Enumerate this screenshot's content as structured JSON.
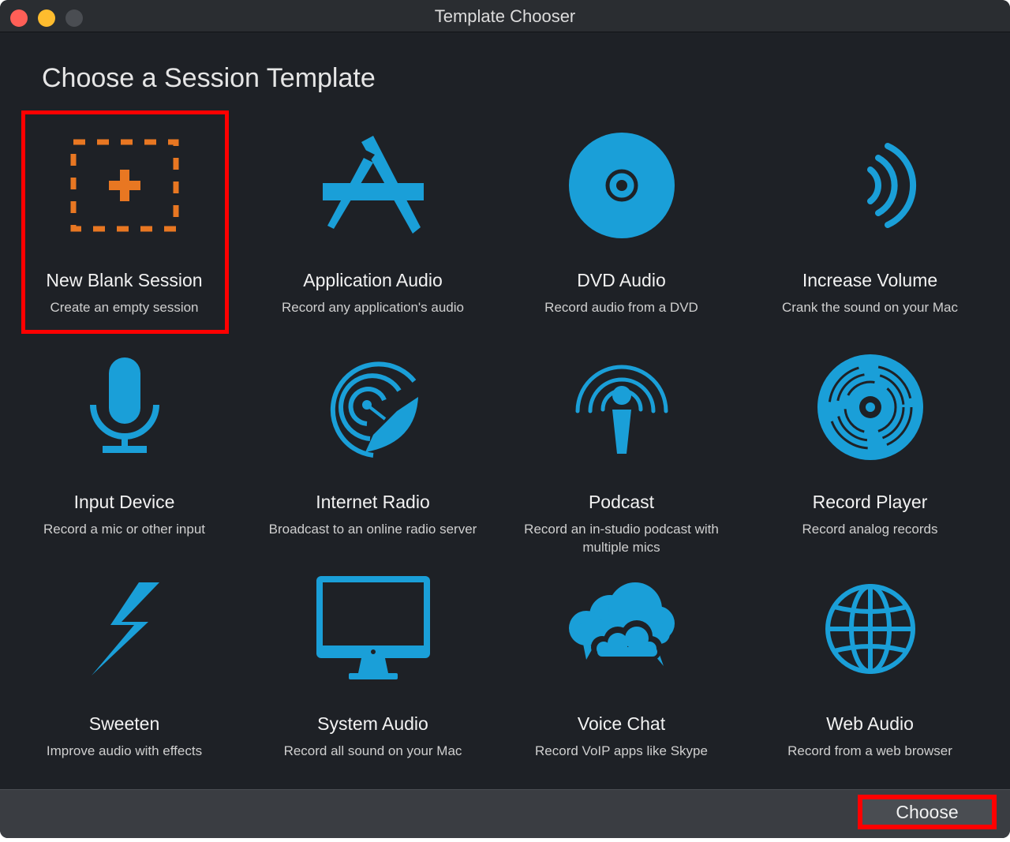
{
  "window": {
    "title": "Template Chooser"
  },
  "heading": "Choose a Session Template",
  "accent_color": "#1a9fd8",
  "selected_color": "#e87722",
  "templates": [
    {
      "icon": "new-blank-session-icon",
      "title": "New Blank Session",
      "desc": "Create an empty session",
      "selected": true
    },
    {
      "icon": "app-store-icon",
      "title": "Application Audio",
      "desc": "Record any application's audio"
    },
    {
      "icon": "disc-icon",
      "title": "DVD Audio",
      "desc": "Record audio from a DVD"
    },
    {
      "icon": "sound-waves-icon",
      "title": "Increase Volume",
      "desc": "Crank the sound on your Mac"
    },
    {
      "icon": "microphone-icon",
      "title": "Input Device",
      "desc": "Record a mic or other input"
    },
    {
      "icon": "satellite-dish-icon",
      "title": "Internet Radio",
      "desc": "Broadcast to an online radio server"
    },
    {
      "icon": "podcast-icon",
      "title": "Podcast",
      "desc": "Record an in-studio podcast with multiple mics"
    },
    {
      "icon": "vinyl-record-icon",
      "title": "Record Player",
      "desc": "Record analog records"
    },
    {
      "icon": "lightning-bolt-icon",
      "title": "Sweeten",
      "desc": "Improve audio with effects"
    },
    {
      "icon": "computer-monitor-icon",
      "title": "System Audio",
      "desc": "Record all sound on your Mac"
    },
    {
      "icon": "clouds-icon",
      "title": "Voice Chat",
      "desc": "Record VoIP apps like Skype"
    },
    {
      "icon": "globe-icon",
      "title": "Web Audio",
      "desc": "Record from a web browser"
    }
  ],
  "footer": {
    "choose_label": "Choose"
  }
}
